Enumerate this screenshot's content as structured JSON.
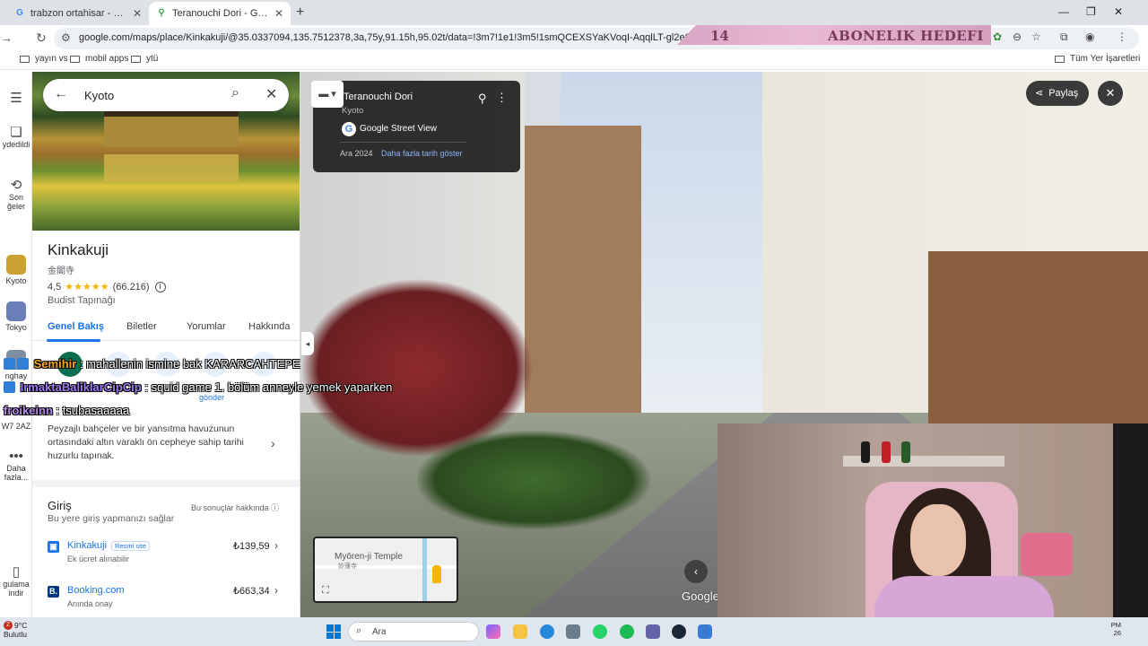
{
  "browser": {
    "tabs": [
      {
        "title": "trabzon ortahisar - Google'da A",
        "active": false,
        "favicon": "G"
      },
      {
        "title": "Teranouchi Dori - Google Harita",
        "active": true,
        "favicon": "map-pin"
      }
    ],
    "url": "google.com/maps/place/Kinkakuji/@35.0337094,135.7512378,3a,75y,91.15h,95.02t/data=!3m7!1e1!3m5!1smQCEXSYaKVoqI-AqqlLT-gl2e0!6shttps:%2F%2Fstreetvie",
    "bookmarks": [
      "yayın vs",
      "mobil apps",
      "ytü"
    ],
    "all_bookmarks": "Tüm Yer İşaretleri"
  },
  "stream_goal": {
    "number": "14",
    "text": "ABONELIK HEDEFI"
  },
  "rail": {
    "items": [
      {
        "label": "ydedildi",
        "icon": "bookmark-icon"
      },
      {
        "label": "Son ğeler",
        "icon": "history-icon"
      },
      {
        "label": "Kyoto",
        "icon": "thumb"
      },
      {
        "label": "Tokyo",
        "icon": "thumb"
      },
      {
        "label": "nghay",
        "icon": "thumb"
      },
      {
        "label": "W7 2AZ",
        "icon": "thumb"
      },
      {
        "label": "Daha fazla...",
        "icon": "more-icon"
      },
      {
        "label": "gulama indir",
        "icon": "phone-icon"
      }
    ]
  },
  "search": {
    "query": "Kyoto"
  },
  "place": {
    "name": "Kinkakuji",
    "name_jp": "金閣寺",
    "rating": "4,5",
    "stars": "★★★★★",
    "reviews": "(66.216)",
    "type": "Budist Tapınağı",
    "tabs": [
      "Genel Bakış",
      "Biletler",
      "Yorumlar",
      "Hakkında"
    ],
    "send_label": "gönder",
    "description": "Peyzajlı bahçeler ve bir yansıtma havuzunun ortasındaki altın varaklı ön cepheye sahip tarihi huzurlu tapınak.",
    "entry_title": "Giriş",
    "entry_sub": "Bu yere giriş yapmanızı sağlar",
    "about_results": "Bu sonuçlar hakkında",
    "offers": [
      {
        "name": "Kinkakuji",
        "badge": "Resmi site",
        "sub": "Ek ücret alınabilir",
        "price": "₺139,59",
        "color": "#1a73e8",
        "logo": "▣"
      },
      {
        "name": "Booking.com",
        "badge": "",
        "sub": "Anında onay",
        "price": "₺663,34",
        "color": "#003580",
        "logo": "B."
      }
    ]
  },
  "streetview": {
    "title": "Teranouchi Dori",
    "subtitle": "Kyoto",
    "source": "Google Street View",
    "date": "Ara 2024",
    "more_dates": "Daha fazla tarih göster",
    "share": "Paylaş",
    "watermark": "Google",
    "minimap_label": "Myōren-ji Temple",
    "minimap_sub": "妙蓮寺"
  },
  "chat": [
    {
      "user": "Semihir",
      "message": ": mahallenin ismine bak KARARCAHTEPE",
      "user_color": "#f6a623"
    },
    {
      "user": "IrmaktaBaliklarCipCip",
      "message": ": squid game  1. bölüm anneyle yemek yaparken",
      "user_color": "#9c7cf4"
    },
    {
      "user": "froikeinn",
      "message": ": tsubasaaaaa",
      "user_color": "#b48cf0"
    }
  ],
  "taskbar": {
    "weather_temp": "9°C",
    "weather_desc": "Bulutlu",
    "notification_count": "2",
    "search_placeholder": "Ara",
    "tray_time": "PM",
    "tray_date": "26"
  }
}
